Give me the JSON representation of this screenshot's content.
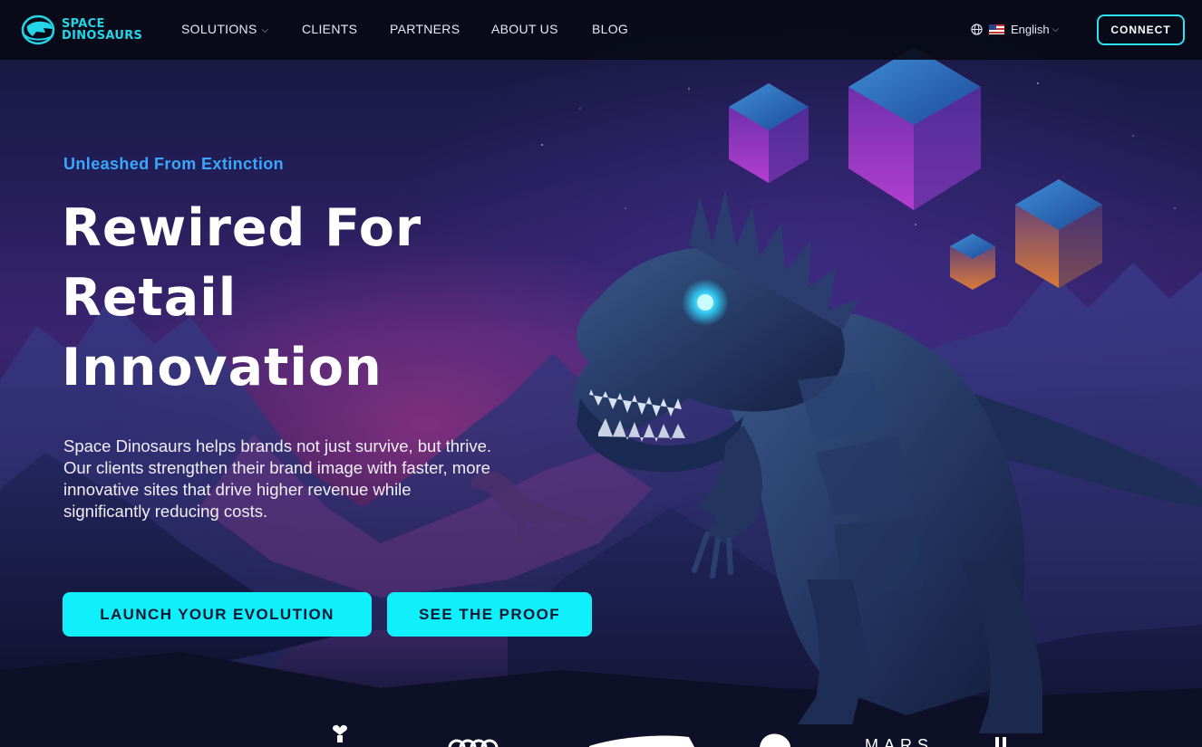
{
  "brand": {
    "line1": "SPACE",
    "line2": "DINOSAURS"
  },
  "nav": {
    "links": [
      {
        "label": "SOLUTIONS",
        "has_dropdown": true
      },
      {
        "label": "CLIENTS"
      },
      {
        "label": "PARTNERS"
      },
      {
        "label": "ABOUT US"
      },
      {
        "label": "BLOG"
      }
    ],
    "language": "English",
    "connect_label": "CONNECT"
  },
  "hero": {
    "eyebrow": "Unleashed From Extinction",
    "title_lines": [
      "Rewired For",
      "Retail",
      "Innovation"
    ],
    "description": "Space Dinosaurs helps brands not just survive, but thrive. Our clients strengthen their brand image with faster, more innovative sites that drive higher revenue while significantly reducing costs.",
    "primary_cta": "LAUNCH YOUR EVOLUTION",
    "secondary_cta": "SEE THE PROOF"
  },
  "colors": {
    "accent": "#0ff0fb",
    "eyebrow": "#3aa7ff",
    "logo": "#22d6e8",
    "button_text": "#0f1733"
  },
  "icons": [
    "logo-mark-icon",
    "globe-icon",
    "us-flag-icon",
    "chevron-down-icon"
  ]
}
